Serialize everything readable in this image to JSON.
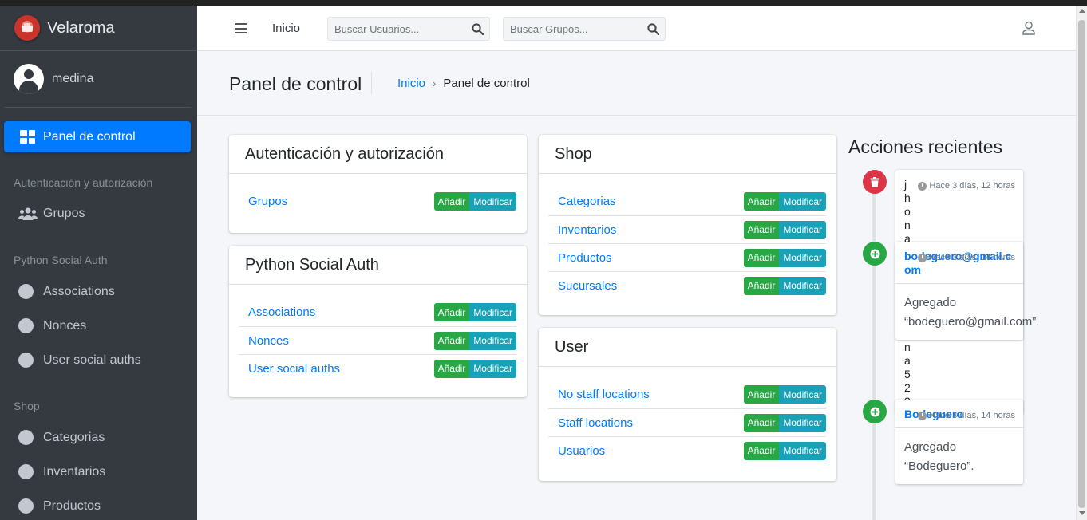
{
  "brand": {
    "name": "Velaroma"
  },
  "user": {
    "name": "medina"
  },
  "sidebar": {
    "active": "Panel de control",
    "sections": [
      {
        "header": "Autenticación y autorización",
        "items": [
          "Grupos"
        ]
      },
      {
        "header": "Python Social Auth",
        "items": [
          "Associations",
          "Nonces",
          "User social auths"
        ]
      },
      {
        "header": "Shop",
        "items": [
          "Categorias",
          "Inventarios",
          "Productos"
        ]
      }
    ]
  },
  "topbar": {
    "home": "Inicio",
    "search_users_placeholder": "Buscar Usuarios...",
    "search_groups_placeholder": "Buscar Grupos..."
  },
  "page": {
    "title": "Panel de control",
    "breadcrumb": {
      "home": "Inicio",
      "sep": "›",
      "current": "Panel de control"
    }
  },
  "buttons": {
    "add": "Añadir",
    "modify": "Modificar"
  },
  "apps": [
    {
      "title": "Autenticación y autorización",
      "models": [
        "Grupos"
      ]
    },
    {
      "title": "Python Social Auth",
      "models": [
        "Associations",
        "Nonces",
        "User social auths"
      ]
    },
    {
      "title": "Shop",
      "models": [
        "Categorias",
        "Inventarios",
        "Productos",
        "Sucursales"
      ]
    },
    {
      "title": "User",
      "models": [
        "No staff locations",
        "Staff locations",
        "Usuarios"
      ]
    }
  ],
  "recent": {
    "title": "Acciones recientes",
    "actions": [
      {
        "type": "delete",
        "time": "Hace 3 días, 12 horas",
        "user": "jhonatanmedina523",
        "text": ""
      },
      {
        "type": "add",
        "time": "Hace 3 días, 14 horas",
        "user": "bodeguero@gmail.com",
        "text": "Agregado “bodeguero@gmail.com”."
      },
      {
        "type": "add",
        "time": "Hace 3 días, 14 horas",
        "user": "Bodeguero",
        "text": "Agregado “Bodeguero”."
      }
    ]
  },
  "colors": {
    "sidebar": "#343a40",
    "active": "#007bff",
    "add": "#28a745",
    "modify": "#17a2b8",
    "delete": "#dc3545"
  }
}
